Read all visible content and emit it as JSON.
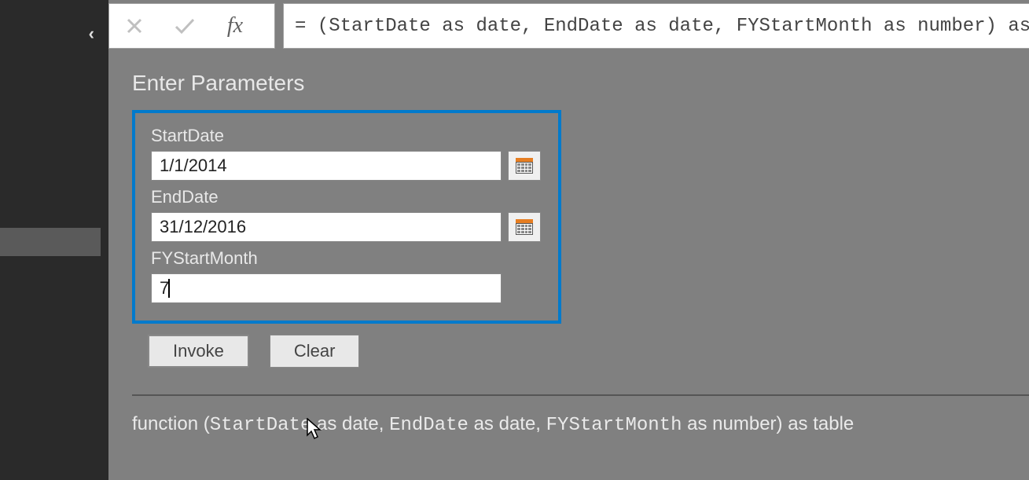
{
  "formula_bar": {
    "text": "= (StartDate as date, EndDate as date, FYStartMonth as number) as table"
  },
  "title": "Enter Parameters",
  "params": {
    "startdate_label": "StartDate",
    "startdate_value": "1/1/2014",
    "enddate_label": "EndDate",
    "enddate_value": "31/12/2016",
    "fystartmonth_label": "FYStartMonth",
    "fystartmonth_value": "7"
  },
  "buttons": {
    "invoke": "Invoke",
    "clear": "Clear"
  },
  "signature": {
    "prefix": "function (",
    "p1": "StartDate",
    "as_date1": " as date, ",
    "p2": "EndDate",
    "as_date2": " as date, ",
    "p3": "FYStartMonth",
    "as_number": " as number) as table"
  }
}
